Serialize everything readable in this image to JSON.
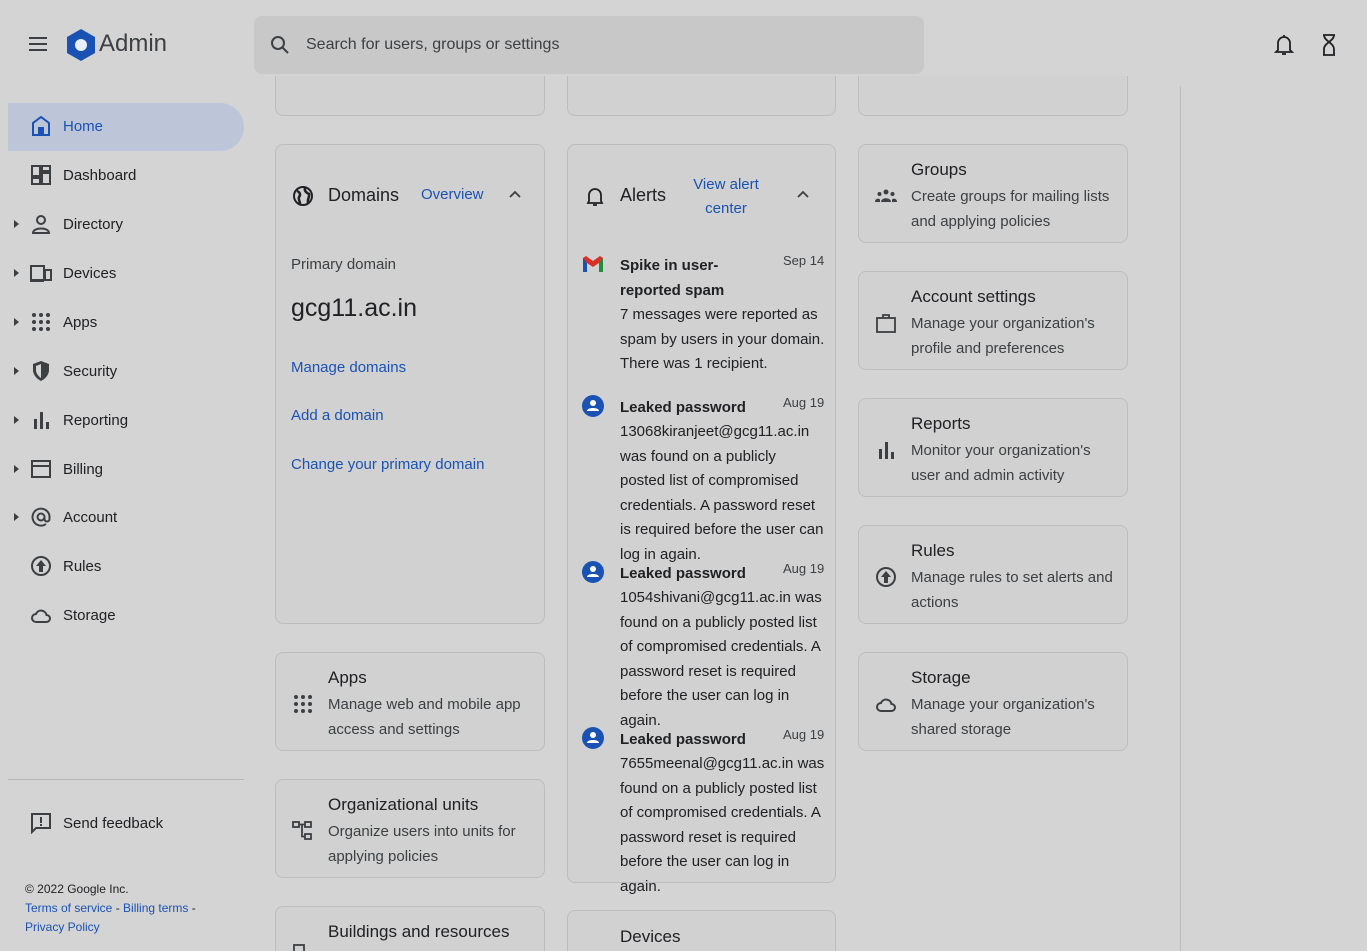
{
  "header": {
    "app_title": "Admin",
    "search_placeholder": "Search for users, groups or settings"
  },
  "sidebar": {
    "items": [
      {
        "label": "Home",
        "icon": "home-icon",
        "active": true
      },
      {
        "label": "Dashboard",
        "icon": "dashboard-icon"
      },
      {
        "label": "Directory",
        "icon": "person-icon"
      },
      {
        "label": "Devices",
        "icon": "devices-icon"
      },
      {
        "label": "Apps",
        "icon": "apps-grid-icon"
      },
      {
        "label": "Security",
        "icon": "shield-icon"
      },
      {
        "label": "Reporting",
        "icon": "bar-chart-icon"
      },
      {
        "label": "Billing",
        "icon": "billing-icon"
      },
      {
        "label": "Account",
        "icon": "at-sign-icon"
      },
      {
        "label": "Rules",
        "icon": "rules-icon"
      },
      {
        "label": "Storage",
        "icon": "cloud-icon"
      }
    ],
    "feedback_label": "Send feedback",
    "copyright": "© 2022 Google Inc.",
    "terms_link": "Terms of service",
    "billing_terms_link": "Billing terms",
    "privacy_link": "Privacy Policy",
    "separator": " - "
  },
  "domains_card": {
    "title": "Domains",
    "overview_link": "Overview",
    "primary_label": "Primary domain",
    "primary_domain": "gcg11.ac.in",
    "links": [
      "Manage domains",
      "Add a domain",
      "Change your primary domain"
    ]
  },
  "alerts_card": {
    "title": "Alerts",
    "view_link_line1": "View alert",
    "view_link_line2": "center",
    "items": [
      {
        "title": "Spike in user-reported spam",
        "date": "Sep 14",
        "body": "7 messages were reported as spam by users in your domain. There was 1 recipient.",
        "icon": "gmail-icon"
      },
      {
        "title": "Leaked password",
        "date": "Aug 19",
        "body": "13068kiranjeet@gcg11.ac.in was found on a publicly posted list of compromised credentials. A password reset is required before the user can log in again.",
        "icon": "user-alert-icon"
      },
      {
        "title": "Leaked password",
        "date": "Aug 19",
        "body": "1054shivani@gcg11.ac.in was found on a publicly posted list of compromised credentials. A password reset is required before the user can log in again.",
        "icon": "user-alert-icon"
      },
      {
        "title": "Leaked password",
        "date": "Aug 19",
        "body": "7655meenal@gcg11.ac.in was found on a publicly posted list of compromised credentials. A password reset is required before the user can log in again.",
        "icon": "user-alert-icon"
      }
    ]
  },
  "apps_card": {
    "title": "Apps",
    "description": "Manage web and mobile app access and settings"
  },
  "org_units_card": {
    "title": "Organizational units",
    "description": "Organize users into units for applying policies"
  },
  "buildings_card": {
    "title": "Buildings and resources"
  },
  "devices_card": {
    "title": "Devices"
  },
  "right_tiles": [
    {
      "title": "Groups",
      "description": "Create groups for mailing lists and applying policies",
      "icon": "groups-icon"
    },
    {
      "title": "Account settings",
      "description": "Manage your organization's profile and preferences",
      "icon": "briefcase-icon"
    },
    {
      "title": "Reports",
      "description": "Monitor your organization's user and admin activity",
      "icon": "bar-chart-icon"
    },
    {
      "title": "Rules",
      "description": "Manage rules to set alerts and actions",
      "icon": "rules-icon"
    },
    {
      "title": "Storage",
      "description": "Manage your organization's shared storage",
      "icon": "cloud-icon"
    }
  ],
  "colors": {
    "link": "#1a52b4",
    "background": "#d4d4d4",
    "active_nav": "#bcc6d8"
  }
}
